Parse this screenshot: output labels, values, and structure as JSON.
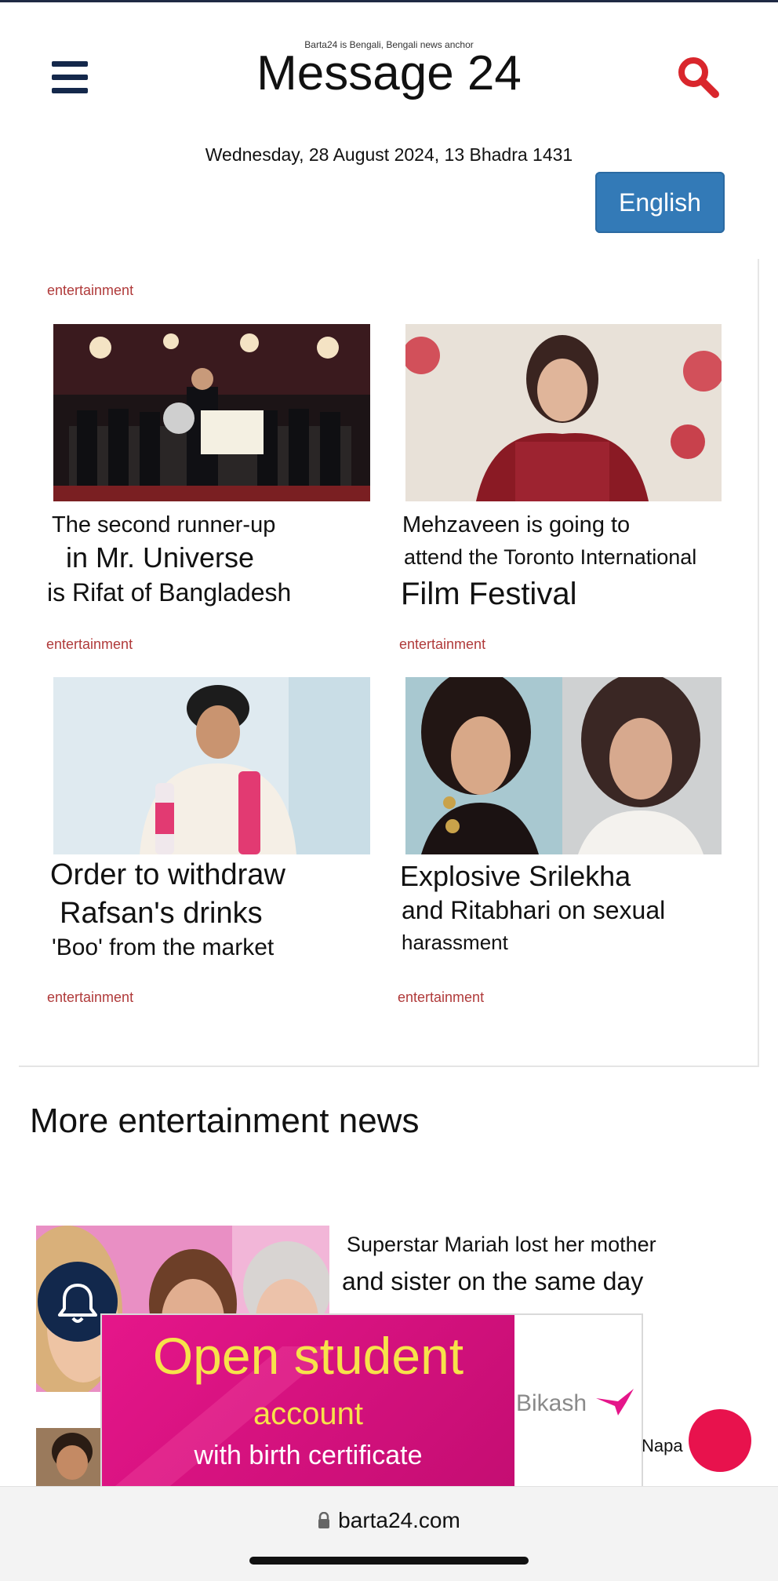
{
  "header": {
    "tagline": "Barta24 is Bengali, Bengali news anchor",
    "site_title": "Message 24",
    "date": "Wednesday, 28 August 2024, 13 Bhadra 1431",
    "language_button": "English",
    "menu_icon": "hamburger-menu-icon",
    "search_icon": "search-icon"
  },
  "articles": [
    {
      "category": "entertainment",
      "headline_lines": [
        "The second runner-up",
        "in Mr. Universe",
        "is Rifat of Bangladesh"
      ],
      "category_below": "entertainment"
    },
    {
      "headline_lines": [
        "Mehzaveen is going to",
        "attend the Toronto International",
        "Film Festival"
      ],
      "category_below": "entertainment"
    },
    {
      "headline_lines": [
        "Order to withdraw",
        "Rafsan's drinks",
        "'Boo' from the market"
      ],
      "category_below": "entertainment"
    },
    {
      "headline_lines": [
        "Explosive Srilekha",
        "and Ritabhari on sexual",
        "harassment"
      ],
      "category_below": "entertainment"
    }
  ],
  "more_section": {
    "title": "More entertainment news",
    "items": [
      {
        "headline_lines": [
          "Superstar Mariah lost her mother",
          "and sister on the same day"
        ]
      },
      {
        "headline_partial": "Napa"
      }
    ]
  },
  "ad": {
    "line1": "Open student",
    "line2": "account",
    "line3": "with birth certificate",
    "brand": "Bikash",
    "accent": "#e5168a"
  },
  "browser": {
    "url": "barta24.com",
    "lock_icon": "lock-icon"
  },
  "floating": {
    "bell_icon": "bell-icon",
    "fab_color": "#e8124d"
  },
  "colors": {
    "brand_navy": "#12284c",
    "category_red": "#b03a3a",
    "search_red": "#d9262c",
    "button_blue": "#337ab7"
  }
}
